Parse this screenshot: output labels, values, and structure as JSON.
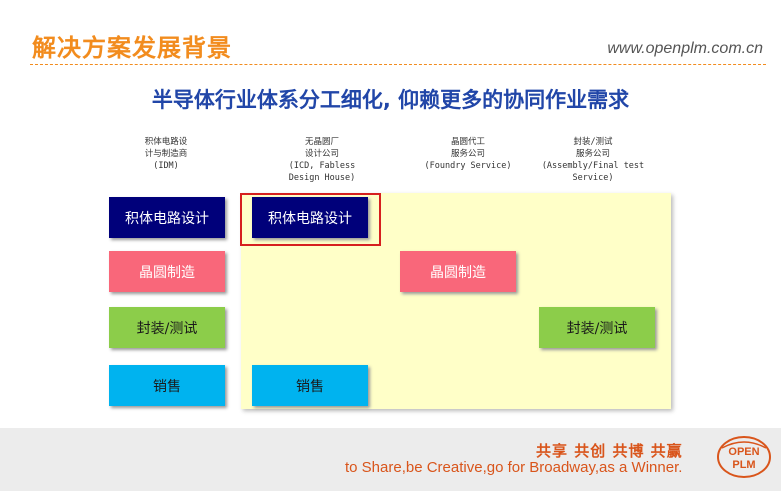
{
  "header": {
    "title": "解决方案发展背景",
    "url": "www.openplm.com.cn"
  },
  "subtitle": "半导体行业体系分工细化, 仰赖更多的协同作业需求",
  "columns": [
    "积体电路设\n计与制造商\n(IDM)",
    "无晶圆厂\n设计公司\n(ICD, Fabless\nDesign House)",
    "晶圆代工\n服务公司\n(Foundry Service)",
    "封装/测试\n服务公司\n(Assembly/Final test\nService)"
  ],
  "boxes": {
    "ic_design": "积体电路设计",
    "wafer_fab": "晶圆制造",
    "package_test": "封装/测试",
    "sales": "销售"
  },
  "footer": {
    "slogan_cn": "共享 共创 共博 共赢",
    "slogan_en": "to Share,be Creative,go for Broadway,as a Winner.",
    "logo_top": "OPEN",
    "logo_bottom": "PLM"
  },
  "colors": {
    "accent": "#f28c1e",
    "subtitle": "#2146a8",
    "navy": "#00007a",
    "pink": "#f9677a",
    "green": "#8ccd4a",
    "cyan": "#00b3ef",
    "highlight": "#d61f1f",
    "footer_text": "#d9551b"
  }
}
